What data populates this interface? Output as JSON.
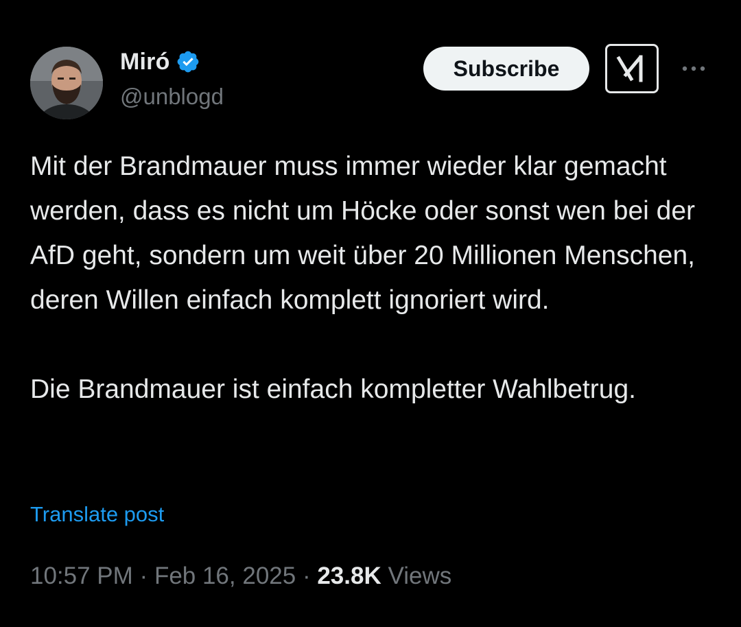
{
  "author": {
    "display_name": "Miró",
    "handle": "@unblogd",
    "verified_badge": "verified-check-icon",
    "avatar_icon": "user-avatar"
  },
  "actions": {
    "subscribe_label": "Subscribe",
    "grok_icon": "grok-icon",
    "more_icon": "more-options-icon"
  },
  "post": {
    "paragraph_1": "Mit der Brandmauer muss immer wieder klar gemacht werden, dass es nicht um Höcke oder sonst wen bei der AfD geht, sondern um weit über 20 Millionen Menschen, deren Willen einfach komplett ignoriert wird.",
    "paragraph_2": "Die Brandmauer ist einfach kompletter Wahlbetrug.",
    "translate_label": "Translate post"
  },
  "meta": {
    "time": "10:57 PM",
    "separator": "·",
    "date": "Feb 16, 2025",
    "views_count": "23.8K",
    "views_label": "Views"
  },
  "colors": {
    "background": "#000000",
    "text": "#e7e9ea",
    "secondary_text": "#71767b",
    "link": "#1d9bf0",
    "verified": "#1d9bf0"
  }
}
